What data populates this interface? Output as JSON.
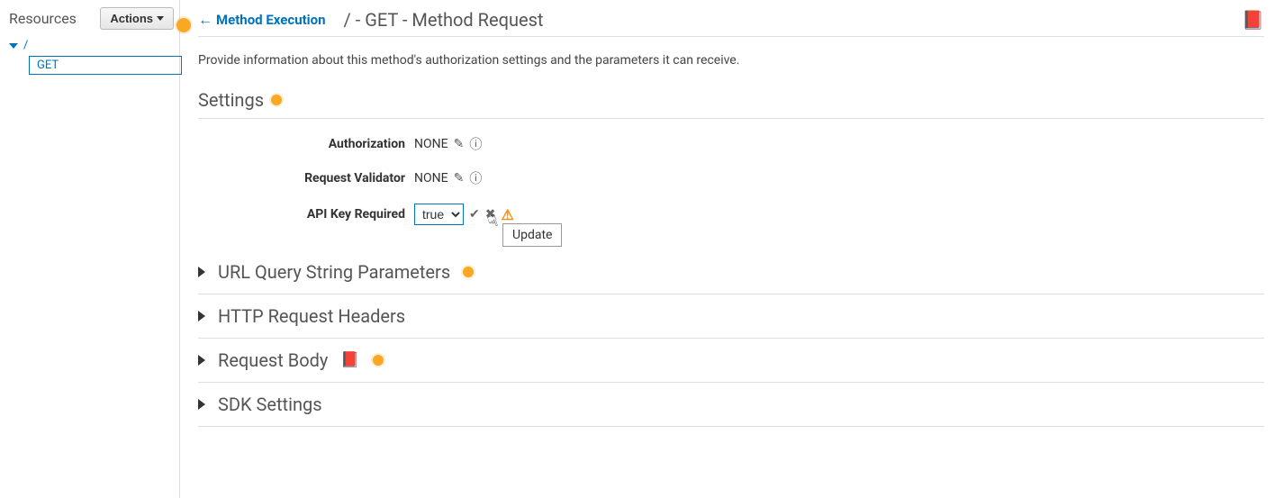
{
  "sidebar": {
    "title": "Resources",
    "actions_label": "Actions",
    "root_label": "/",
    "method_label": "GET"
  },
  "header": {
    "back_link": "Method Execution",
    "title": "/ - GET - Method Request"
  },
  "description": "Provide information about this method's authorization settings and the parameters it can receive.",
  "settings": {
    "heading": "Settings",
    "rows": {
      "authorization": {
        "label": "Authorization",
        "value": "NONE"
      },
      "validator": {
        "label": "Request Validator",
        "value": "NONE"
      },
      "api_key": {
        "label": "API Key Required",
        "selected": "true"
      }
    }
  },
  "tooltip": "Update",
  "sections": {
    "url_query": "URL Query String Parameters",
    "http_headers": "HTTP Request Headers",
    "request_body": "Request Body",
    "sdk_settings": "SDK Settings"
  }
}
